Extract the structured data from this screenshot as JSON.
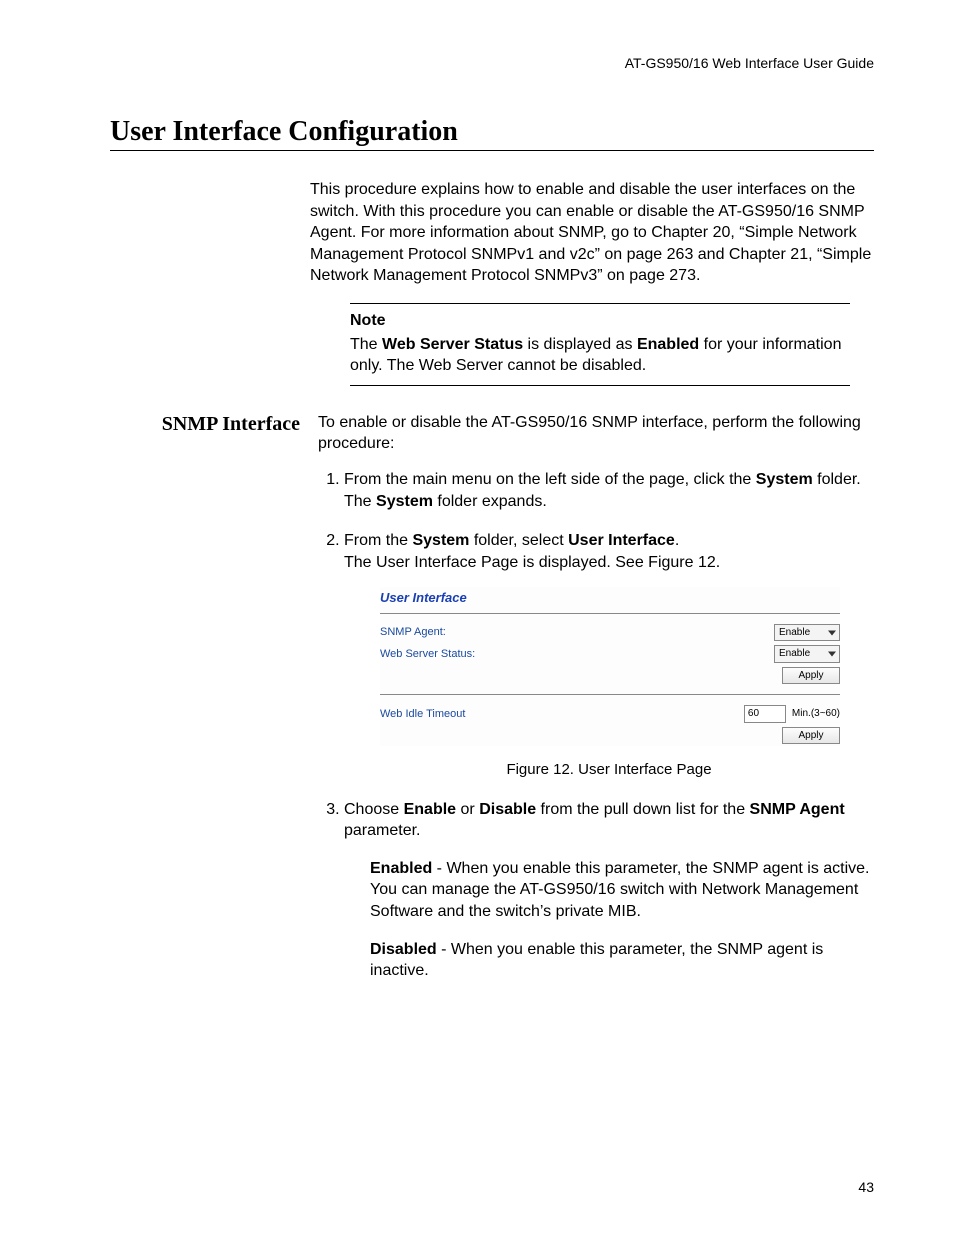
{
  "header": {
    "guide": "AT-GS950/16  Web Interface User Guide"
  },
  "title": "User Interface Configuration",
  "intro": "This procedure explains how to enable and disable the user interfaces on the switch. With this procedure you can enable or disable the AT-GS950/16 SNMP Agent. For more information about SNMP, go to Chapter 20, “Simple Network Management Protocol SNMPv1 and v2c” on page 263 and Chapter 21, “Simple Network Management Protocol SNMPv3” on page 273.",
  "note": {
    "label": "Note",
    "pre": "The ",
    "boldA": "Web Server Status",
    "mid": " is displayed as ",
    "boldB": "Enabled",
    "post": " for your information only. The Web Server cannot be disabled."
  },
  "side_heading": "SNMP Interface",
  "lead": "To enable or disable the AT-GS950/16 SNMP interface, perform the following procedure:",
  "step1": {
    "a": "From the main menu on the left side of the page, click the ",
    "bold": "System",
    "b": " folder.",
    "c": "The ",
    "bold2": "System",
    "d": " folder expands."
  },
  "step2": {
    "a": "From the ",
    "bold": "System",
    "b": " folder, select ",
    "bold2": "User Interface",
    "c": ".",
    "d": "The User Interface Page is displayed. See Figure 12."
  },
  "ui": {
    "title": "User Interface",
    "snmp_label": "SNMP Agent:",
    "web_label": "Web Server Status:",
    "idle_label": "Web Idle Timeout",
    "enable": "Enable",
    "apply": "Apply",
    "timeout_value": "60",
    "timeout_hint": "Min.(3~60)"
  },
  "figure_caption": "Figure 12. User Interface Page",
  "step3": {
    "a": "Choose ",
    "boldA": "Enable",
    "b": " or ",
    "boldB": "Disable",
    "c": " from the pull down list for the ",
    "boldC": "SNMP Agent",
    "d": " parameter."
  },
  "enabled_para": {
    "bold": "Enabled",
    "text": " - When you enable this parameter, the SNMP agent is active. You can manage the AT-GS950/16 switch with Network Management Software and the switch’s private MIB."
  },
  "disabled_para": {
    "bold": "Disabled",
    "text": " - When you enable this parameter, the SNMP agent is inactive."
  },
  "page_number": "43"
}
